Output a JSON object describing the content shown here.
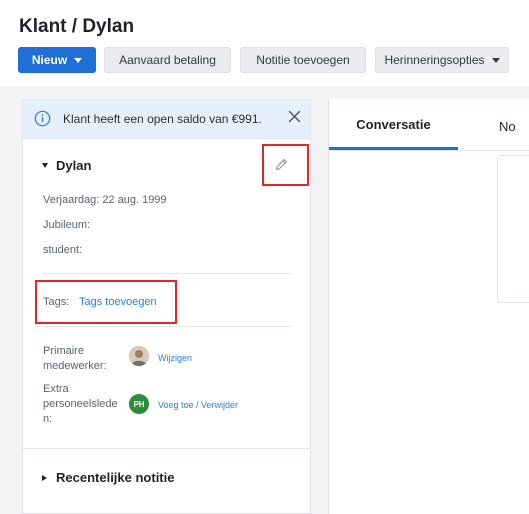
{
  "header": {
    "title": "Klant / Dylan",
    "new_button": "Nieuw",
    "accept_payment": "Aanvaard betaling",
    "add_note": "Notitie toevoegen",
    "reminder_options": "Herinneringsopties"
  },
  "alert": {
    "text": "Klant heeft een open saldo van €991."
  },
  "client": {
    "name": "Dylan",
    "birthday": "Verjaardag: 22 aug. 1999",
    "anniversary": "Jubileum:",
    "category": "student:",
    "tags_label": "Tags:",
    "tags_link": "Tags toevoegen",
    "primary_staff_label_1": "Primaire",
    "primary_staff_label_2": "medewerker:",
    "primary_staff_link": "Wijzigen",
    "extra_staff_label_1": "Extra",
    "extra_staff_label_2": "personeelslede",
    "extra_staff_label_3": "n:",
    "extra_staff_avatar": "PH",
    "extra_staff_link": "Voeg toe / Verwijder"
  },
  "recent_note": {
    "title": "Recentelijke notitie"
  },
  "tabs": {
    "conversation": "Conversatie",
    "next": "No"
  },
  "colors": {
    "primary": "#1f6fd6",
    "link": "#2d7fd8",
    "highlight": "#e0262b",
    "alert_bg": "#e6f0fb"
  }
}
